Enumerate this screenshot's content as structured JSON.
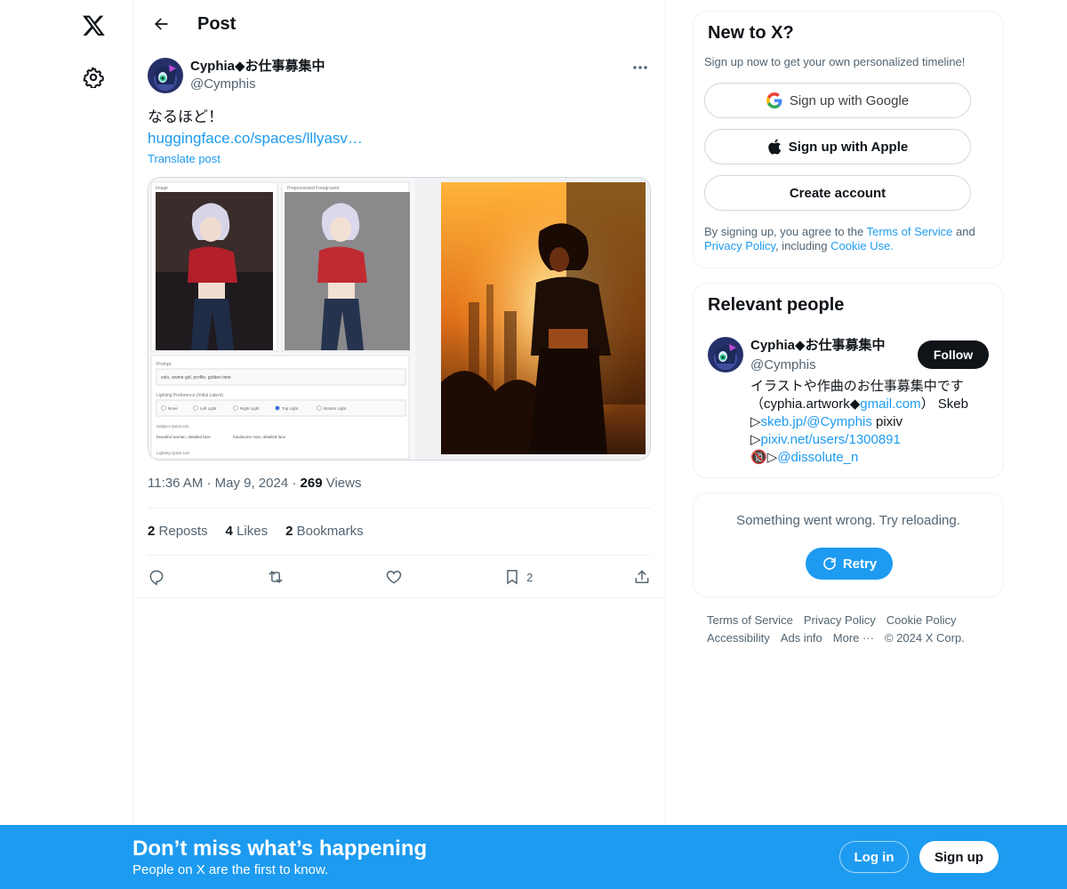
{
  "nav": {
    "logo_icon": "x-logo-icon",
    "settings_icon": "gear-icon"
  },
  "header": {
    "title": "Post",
    "back_icon": "arrow-left-icon"
  },
  "post": {
    "author_name": "Cyphia◆お仕事募集中",
    "author_handle": "@Cymphis",
    "text": "なるほど！",
    "link": "huggingface.co/spaces/lllyasv…",
    "translate": "Translate post",
    "media_panels": {
      "image_label": "Image",
      "processed_label": "Preprocessed Foreground",
      "prompt_label": "Prompt",
      "prompt_value": "solo, anime girl, profile, golden time",
      "lighting_label": "Lighting Preference (Initial Latent)",
      "lighting_options": [
        "None",
        "Left Light",
        "Right Light",
        "Top Light",
        "Bottom Light"
      ],
      "selected_option": "Top Light",
      "quick_list_label": "Subject Quick List",
      "quick_items": [
        "beautiful woman, detailed face",
        "handsome man, detailed face"
      ],
      "lighting_quick_label": "Lighting Quick List"
    },
    "time": "11:36 AM",
    "date": "May 9, 2024",
    "views": "269",
    "views_label": "Views",
    "reposts": "2",
    "reposts_label": "Reposts",
    "likes": "4",
    "likes_label": "Likes",
    "bookmarks": "2",
    "bookmarks_label": "Bookmarks",
    "bookmark_count": "2"
  },
  "signup_card": {
    "title": "New to X?",
    "subtitle": "Sign up now to get your own personalized timeline!",
    "google": "Sign up with Google",
    "apple": "Sign up with Apple",
    "create": "Create account",
    "legal_1": "By signing up, you agree to the ",
    "terms": "Terms of Service",
    "legal_2": " and ",
    "privacy": "Privacy Policy",
    "legal_3": ", including ",
    "cookie": "Cookie Use."
  },
  "relevant": {
    "title": "Relevant people",
    "name": "Cyphia◆お仕事募集中",
    "handle": "@Cymphis",
    "follow": "Follow",
    "bio_1": "イラストや作曲のお仕事募集中です（cyphia.artwork◆",
    "bio_gmail": "gmail.com",
    "bio_2": "） Skeb ▷",
    "bio_skeb": "skeb.jp/@Cymphis",
    "bio_3": " pixiv ▷",
    "bio_pixiv": "pixiv.net/users/1300891",
    "bio_4": " 🔞▷",
    "bio_x": "@dissolute_n"
  },
  "error_card": {
    "message": "Something went wrong. Try reloading.",
    "retry": "Retry"
  },
  "footer": {
    "terms": "Terms of Service",
    "privacy": "Privacy Policy",
    "cookie": "Cookie Policy",
    "accessibility": "Accessibility",
    "ads": "Ads info",
    "more": "More ···",
    "copyright": "© 2024 X Corp."
  },
  "bottom_bar": {
    "title": "Don’t miss what’s happening",
    "subtitle": "People on X are the first to know.",
    "login": "Log in",
    "signup": "Sign up"
  },
  "colors": {
    "accent": "#1d9bf0",
    "text": "#0f1419",
    "muted": "#536471"
  }
}
